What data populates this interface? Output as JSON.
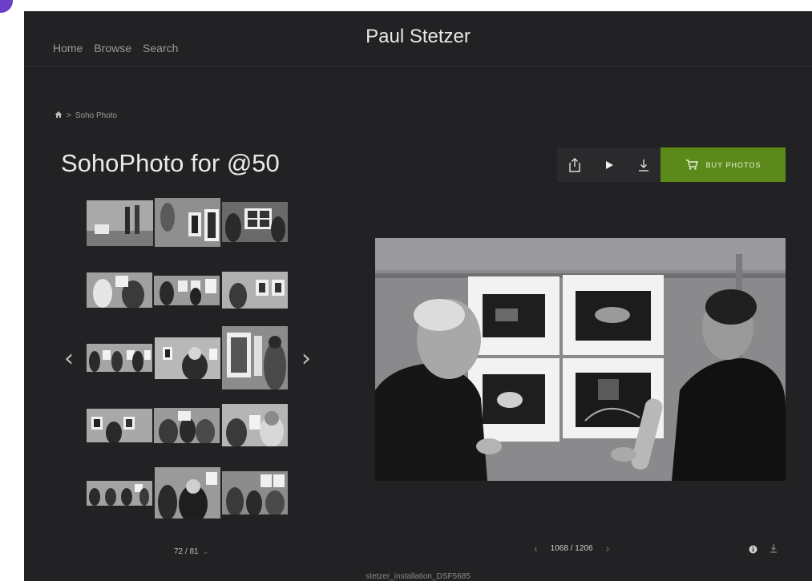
{
  "site": {
    "title": "Paul Stetzer"
  },
  "nav": {
    "items": [
      "Home",
      "Browse",
      "Search"
    ]
  },
  "breadcrumb": {
    "current": "Soho Photo",
    "separator": ">"
  },
  "gallery": {
    "title": "SohoPhoto for @50"
  },
  "toolbar": {
    "buy_label": "BUY PHOTOS"
  },
  "thumb_nav": {
    "prev": "‹",
    "next": "›",
    "counter": "72 / 81",
    "chevron": "⌄"
  },
  "photo_nav": {
    "prev": "‹",
    "next": "›",
    "counter": "1068 / 1206"
  },
  "photo": {
    "filename": "stetzer_installation_DSF5685"
  },
  "colors": {
    "background": "#222224",
    "accent": "#5c8a1a",
    "text": "#eaeaea"
  },
  "icons": [
    "home-icon",
    "share-icon",
    "play-icon",
    "download-icon",
    "cart-icon",
    "info-icon"
  ]
}
